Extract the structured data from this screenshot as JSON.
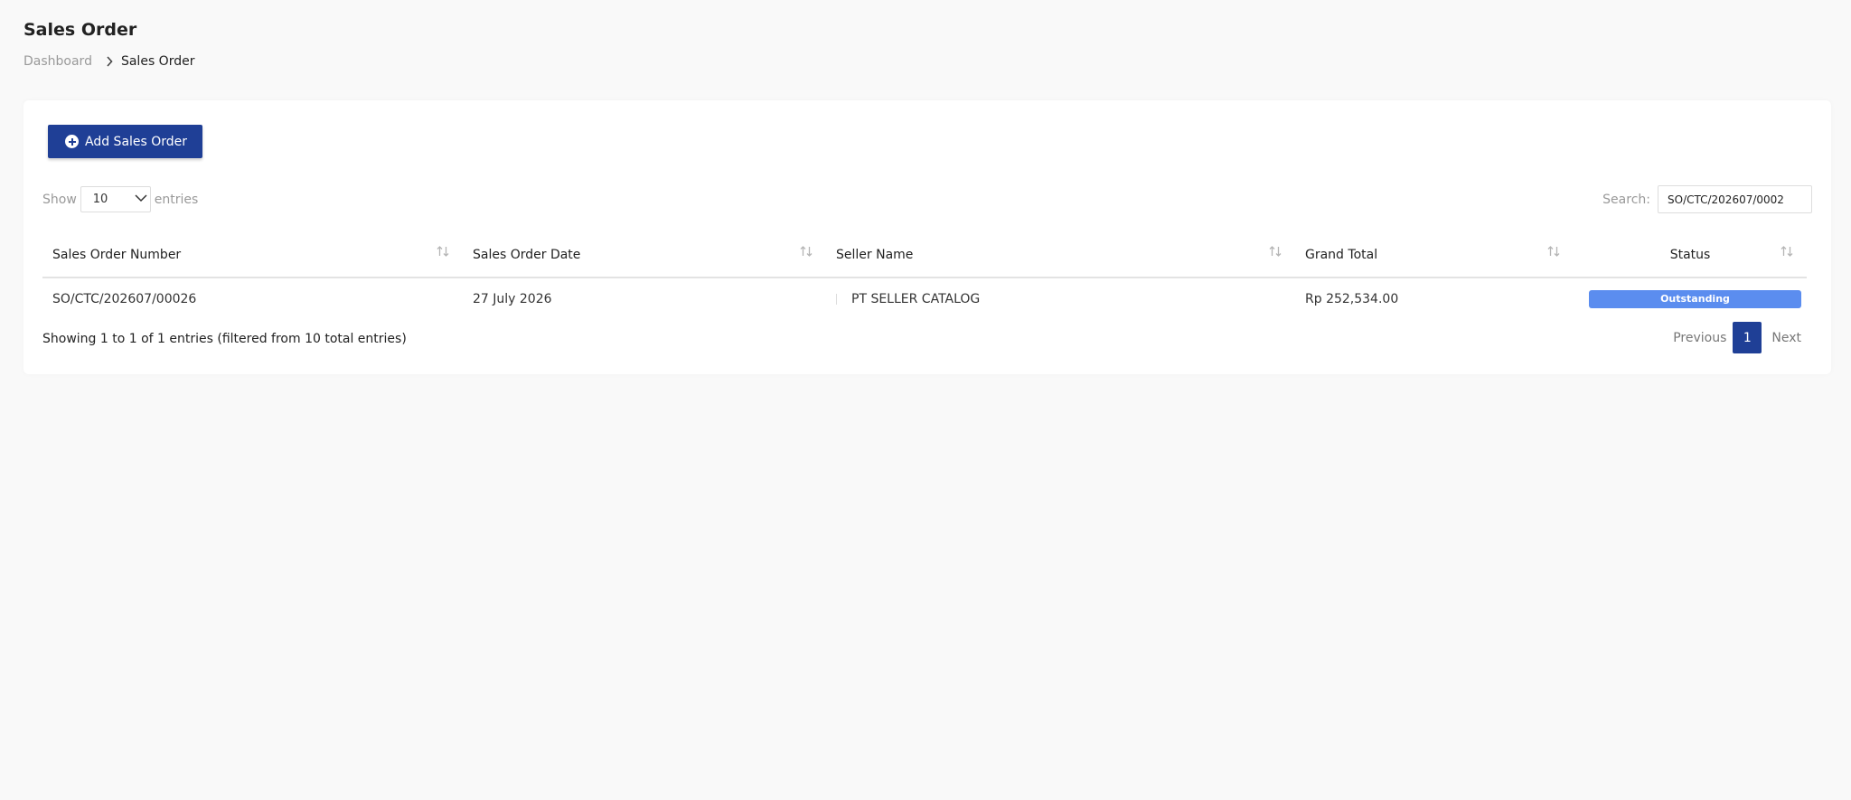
{
  "page": {
    "title": "Sales Order"
  },
  "breadcrumb": {
    "parent": "Dashboard",
    "current": "Sales Order"
  },
  "toolbar": {
    "add_label": "Add Sales Order"
  },
  "length_menu": {
    "prefix": "Show",
    "value": "10",
    "suffix": "entries"
  },
  "search": {
    "label": "Search:",
    "value": "SO/CTC/202607/0002"
  },
  "table": {
    "columns": [
      "Sales Order Number",
      "Sales Order Date",
      "Seller Name",
      "Grand Total",
      "Status"
    ],
    "rows": [
      {
        "number": "SO/CTC/202607/00026",
        "date": "27 July 2026",
        "seller": "PT SELLER CATALOG",
        "total": "Rp 252,534.00",
        "status": "Outstanding"
      }
    ]
  },
  "footer": {
    "info": "Showing 1 to 1 of 1 entries (filtered from 10 total entries)"
  },
  "pagination": {
    "previous": "Previous",
    "current": "1",
    "next": "Next"
  },
  "colors": {
    "primary": "#1f3f96",
    "status_outstanding": "#5b8def",
    "background": "#f9f9f9"
  },
  "icons": [
    "chevron-right-icon",
    "plus-circle-icon",
    "chevron-down-icon",
    "sort-icon"
  ]
}
